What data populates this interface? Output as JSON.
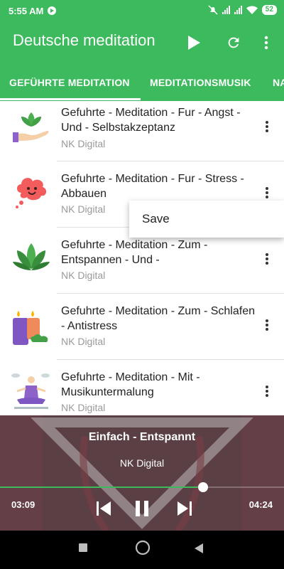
{
  "status": {
    "time": "5:55 AM",
    "battery": "52"
  },
  "appbar": {
    "title": "Deutsche meditation",
    "play_icon": "play-icon",
    "refresh_icon": "refresh-icon",
    "more_icon": "more-vert-icon"
  },
  "tabs": [
    {
      "label": "GEFÜHRTE MEDITATION",
      "selected": true
    },
    {
      "label": "MEDITATIONSMUSIK",
      "selected": false
    },
    {
      "label": "NA",
      "selected": false
    }
  ],
  "tracks": [
    {
      "title": "Gefuhrte - Meditation - Fur - Angst - Und - Selbstakzeptanz",
      "artist": "NK Digital",
      "icon": "lotus-hand-icon"
    },
    {
      "title": "Gefuhrte - Meditation - Fur - Stress - Abbauen",
      "artist": "NK Digital",
      "icon": "cloud-face-icon"
    },
    {
      "title": "Gefuhrte - Meditation - Zum - Entspannen - Und -",
      "artist": "NK Digital",
      "icon": "lotus-icon"
    },
    {
      "title": "Gefuhrte - Meditation - Zum - Schlafen - Antistress",
      "artist": "NK Digital",
      "icon": "candles-icon"
    },
    {
      "title": "Gefuhrte - Meditation - Mit - Musikuntermalung",
      "artist": "NK Digital",
      "icon": "meditating-person-icon"
    }
  ],
  "popup": {
    "save_label": "Save"
  },
  "player": {
    "song": "Einfach - Entspannt",
    "artist": "NK Digital",
    "elapsed": "03:09",
    "duration": "04:24",
    "progress": 0.715
  },
  "colors": {
    "primary": "#3dba5e",
    "player_bg": "#5e4145"
  }
}
